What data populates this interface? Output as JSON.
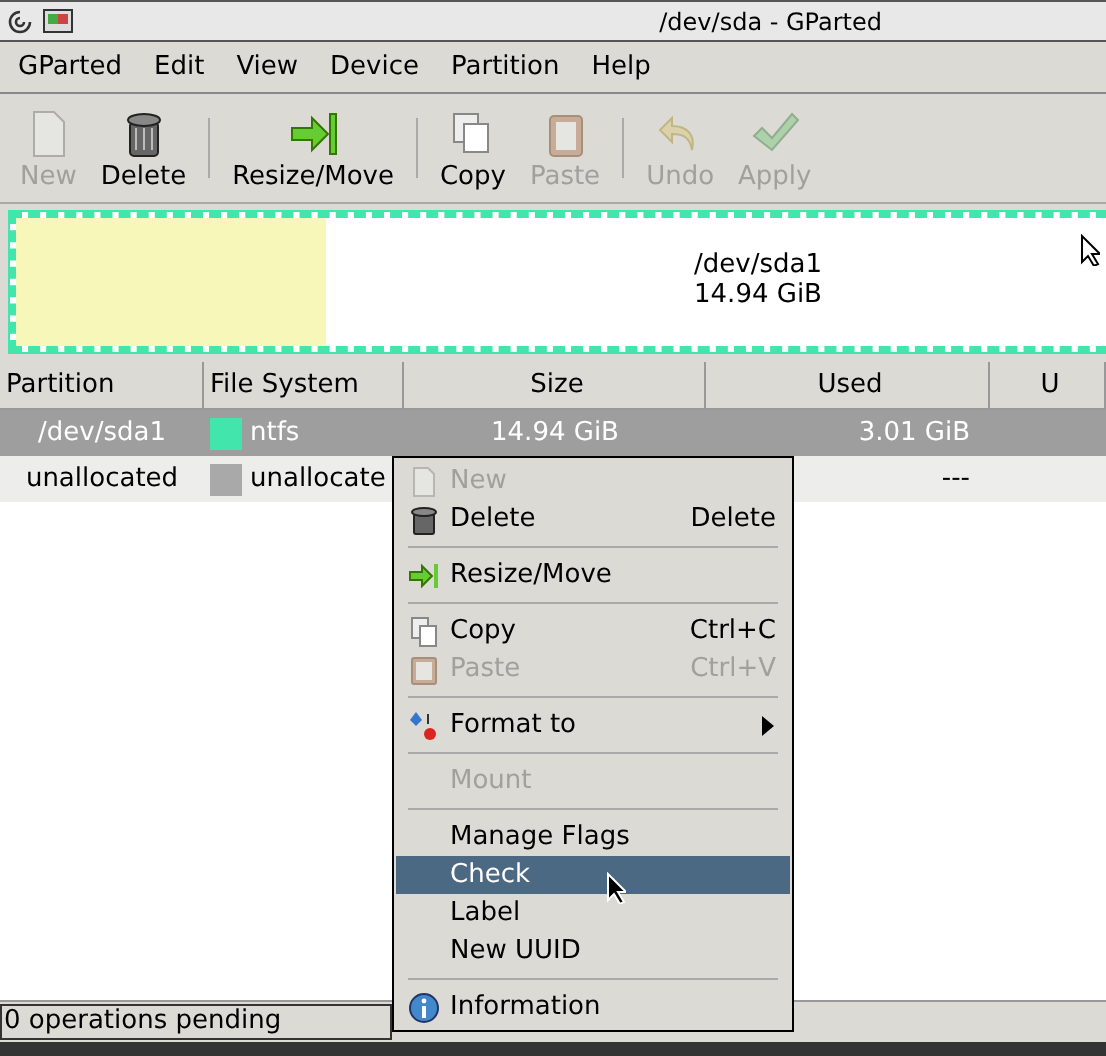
{
  "window": {
    "title": "/dev/sda - GParted"
  },
  "menubar": [
    "GParted",
    "Edit",
    "View",
    "Device",
    "Partition",
    "Help"
  ],
  "toolbar": [
    {
      "label": "New",
      "disabled": true
    },
    {
      "label": "Delete",
      "disabled": false
    },
    {
      "kind": "separator"
    },
    {
      "label": "Resize/Move",
      "disabled": false
    },
    {
      "kind": "separator"
    },
    {
      "label": "Copy",
      "disabled": false
    },
    {
      "label": "Paste",
      "disabled": true
    },
    {
      "kind": "separator"
    },
    {
      "label": "Undo",
      "disabled": true
    },
    {
      "label": "Apply",
      "disabled": true
    }
  ],
  "disk_map": {
    "name": "/dev/sda1",
    "size": "14.94 GiB",
    "level": 0.28,
    "color": "#42e5ac"
  },
  "table": {
    "columns": [
      "Partition",
      "File System",
      "Size",
      "Used",
      "U"
    ],
    "rows": [
      {
        "partition": "/dev/sda1",
        "filesystem": "ntfs",
        "color": "#42e5ac",
        "size": "14.94 GiB",
        "used": "3.01 GiB",
        "selected": true
      },
      {
        "partition": "unallocated",
        "filesystem": "unallocate",
        "color": "#a9a9a9",
        "size": "",
        "used": "---",
        "selected": false
      }
    ]
  },
  "context_menu": [
    {
      "kind": "item",
      "label": "New",
      "disabled": true,
      "selected": false
    },
    {
      "kind": "item",
      "label": "Delete",
      "shortcut": "Delete",
      "disabled": false,
      "selected": false
    },
    {
      "kind": "separator"
    },
    {
      "kind": "item",
      "label": "Resize/Move",
      "disabled": false,
      "selected": false
    },
    {
      "kind": "separator"
    },
    {
      "kind": "item",
      "label": "Copy",
      "shortcut": "Ctrl+C",
      "disabled": false,
      "selected": false
    },
    {
      "kind": "item",
      "label": "Paste",
      "shortcut": "Ctrl+V",
      "disabled": true,
      "selected": false
    },
    {
      "kind": "separator"
    },
    {
      "kind": "submenu",
      "label": "Format to",
      "disabled": false,
      "selected": false
    },
    {
      "kind": "separator"
    },
    {
      "kind": "item",
      "label": "Mount",
      "disabled": true,
      "selected": false
    },
    {
      "kind": "separator"
    },
    {
      "kind": "item",
      "label": "Manage Flags",
      "disabled": false,
      "selected": false
    },
    {
      "kind": "item",
      "label": "Check",
      "disabled": false,
      "selected": true
    },
    {
      "kind": "item",
      "label": "Label",
      "disabled": false,
      "selected": false
    },
    {
      "kind": "item",
      "label": "New UUID",
      "disabled": false,
      "selected": false
    },
    {
      "kind": "separator"
    },
    {
      "kind": "item",
      "label": "Information",
      "disabled": false,
      "selected": false
    }
  ],
  "status_bar": "0 operations pending"
}
